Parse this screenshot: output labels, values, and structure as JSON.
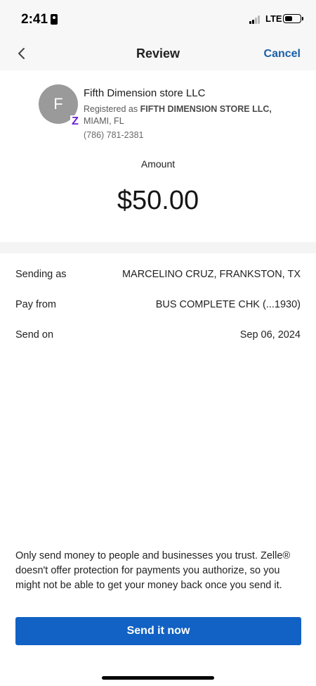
{
  "status_bar": {
    "time": "2:41",
    "network": "LTE"
  },
  "nav": {
    "title": "Review",
    "cancel_label": "Cancel",
    "back_icon": "chevron-left-icon"
  },
  "recipient": {
    "avatar_initial": "F",
    "badge_glyph": "Z",
    "name": "Fifth Dimension store LLC",
    "registered_prefix": "Registered as ",
    "registered_name": "FIFTH DIMENSION STORE LLC,",
    "location": "MIAMI, FL",
    "phone": "(786) 781-2381"
  },
  "amount": {
    "label": "Amount",
    "value": "$50.00"
  },
  "details": [
    {
      "label": "Sending as",
      "value": "MARCELINO CRUZ, FRANKSTON, TX"
    },
    {
      "label": "Pay from",
      "value": "BUS COMPLETE CHK (...1930)"
    },
    {
      "label": "Send on",
      "value": "Sep 06, 2024"
    }
  ],
  "disclaimer": "Only send money to people and businesses you trust. Zelle® doesn't offer protection for payments you authorize, so you might not be able to get your money back once you send it.",
  "send_button_label": "Send it now",
  "colors": {
    "accent": "#1162c4",
    "link": "#1a5fa8",
    "zelle_purple": "#6d1ed4"
  }
}
